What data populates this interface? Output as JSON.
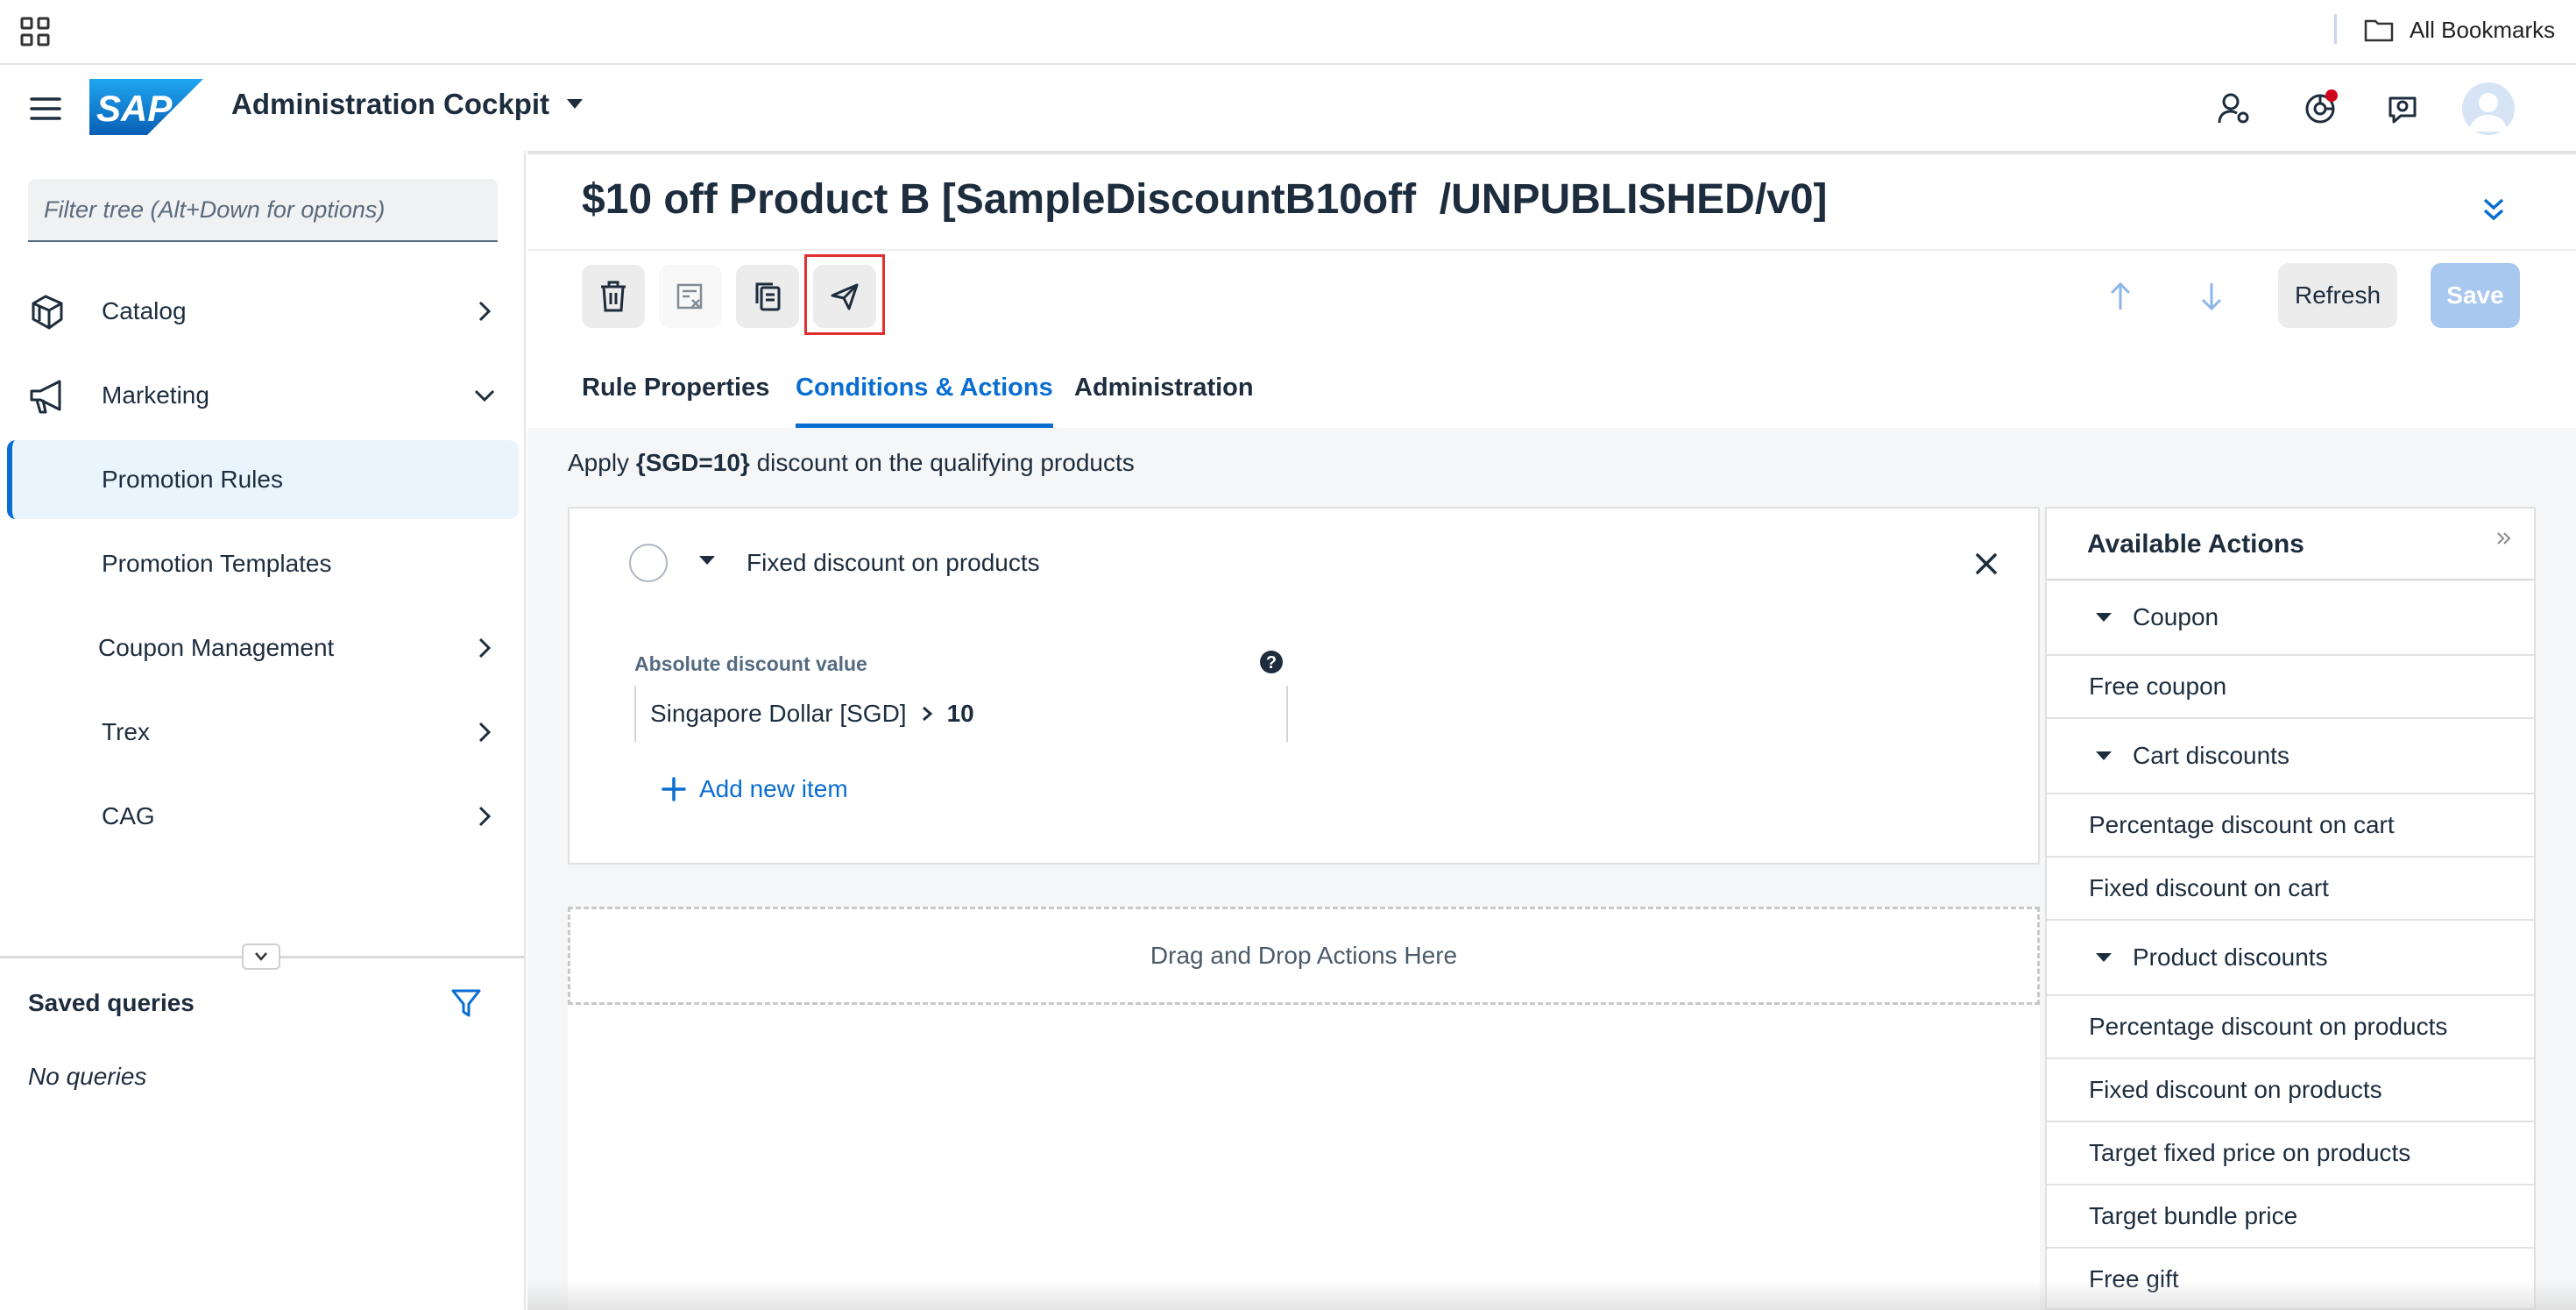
{
  "browser": {
    "all_bookmarks_label": "All Bookmarks"
  },
  "shell": {
    "app_title": "Administration Cockpit",
    "logo_text": "SAP"
  },
  "sidebar": {
    "filter_placeholder": "Filter tree (Alt+Down for options)",
    "items": [
      {
        "label": "Catalog"
      },
      {
        "label": "Marketing"
      },
      {
        "label": "Promotion Rules"
      },
      {
        "label": "Promotion Templates"
      },
      {
        "label": "Coupon Management"
      },
      {
        "label": "Trex"
      },
      {
        "label": "CAG"
      }
    ],
    "saved_queries_title": "Saved queries",
    "no_queries_text": "No queries"
  },
  "object": {
    "title": "$10 off Product B [SampleDiscountB10off  /UNPUBLISHED/v0]",
    "refresh_label": "Refresh",
    "save_label": "Save",
    "tabs": [
      {
        "label": "Rule Properties"
      },
      {
        "label": "Conditions & Actions"
      },
      {
        "label": "Administration"
      }
    ],
    "active_tab": "Conditions & Actions"
  },
  "actions": {
    "apply_prefix": "Apply ",
    "apply_bold": "{SGD=10}",
    "apply_suffix": " discount on the qualifying products",
    "action_name": "Fixed discount on products",
    "field_label": "Absolute discount value",
    "currency": "Singapore Dollar [SGD]",
    "amount": "10",
    "add_item_label": "Add new item",
    "drop_zone_label": "Drag and Drop Actions Here"
  },
  "available_actions": {
    "title": "Available Actions",
    "groups": [
      {
        "name": "Coupon",
        "items": [
          "Free coupon"
        ]
      },
      {
        "name": "Cart discounts",
        "items": [
          "Percentage discount on cart",
          "Fixed discount on cart"
        ]
      },
      {
        "name": "Product discounts",
        "items": [
          "Percentage discount on products",
          "Fixed discount on products",
          "Target fixed price on products",
          "Target bundle price",
          "Free gift"
        ]
      }
    ]
  },
  "colors": {
    "accent": "#0a6ed1",
    "save_disabled": "#a9c8ef",
    "highlight_box": "#e0302f",
    "notification_dot": "#d0021b"
  }
}
